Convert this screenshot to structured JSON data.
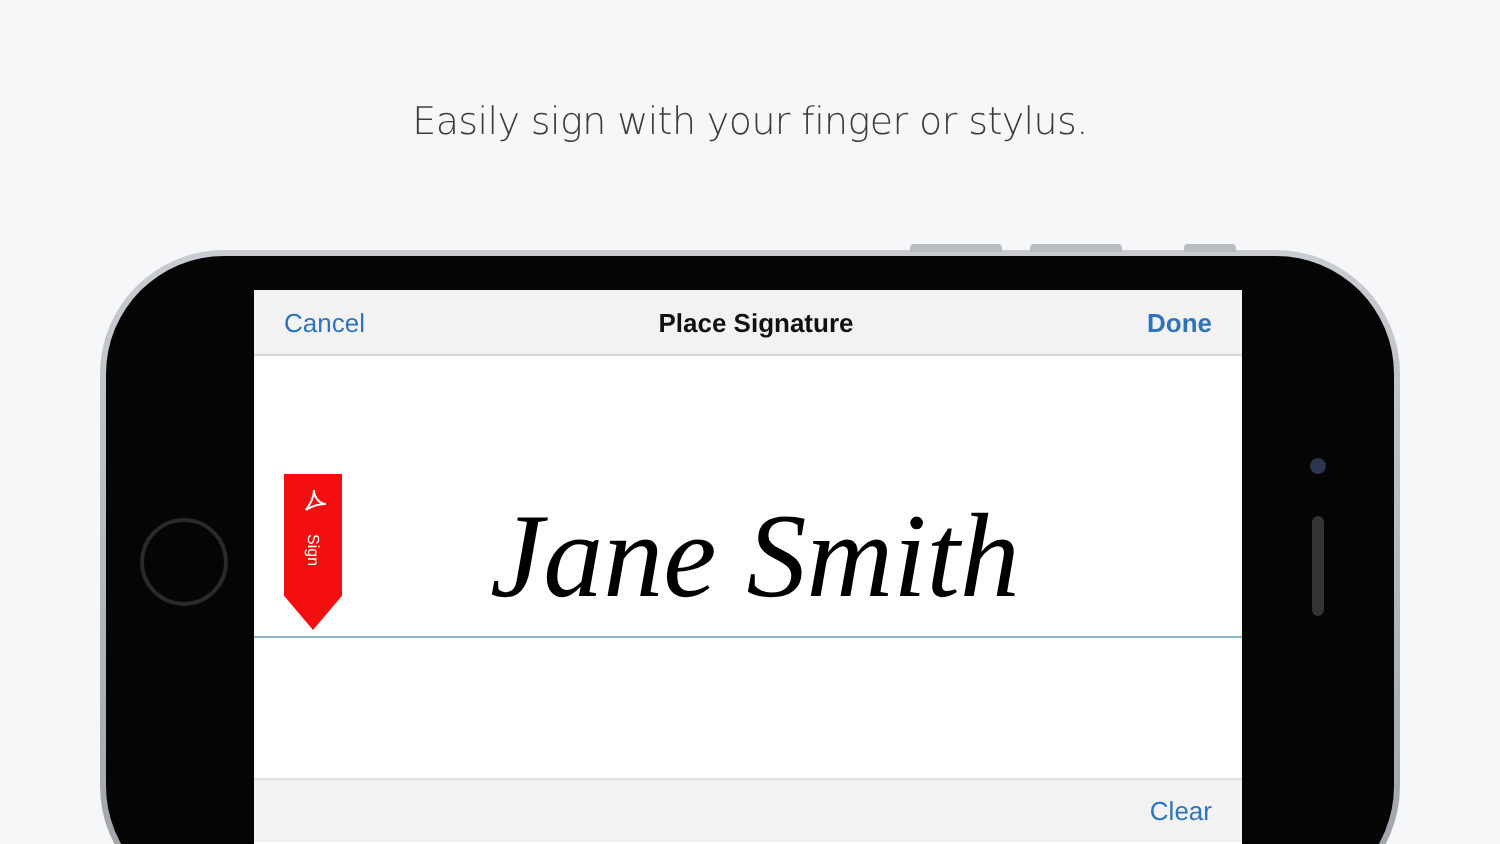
{
  "headline": "Easily sign with your finger or stylus.",
  "nav_bar": {
    "cancel": "Cancel",
    "title": "Place Signature",
    "done": "Done"
  },
  "sign_tab": {
    "label": "Sign"
  },
  "signature": "Jane Smith",
  "bottom_bar": {
    "clear": "Clear"
  }
}
